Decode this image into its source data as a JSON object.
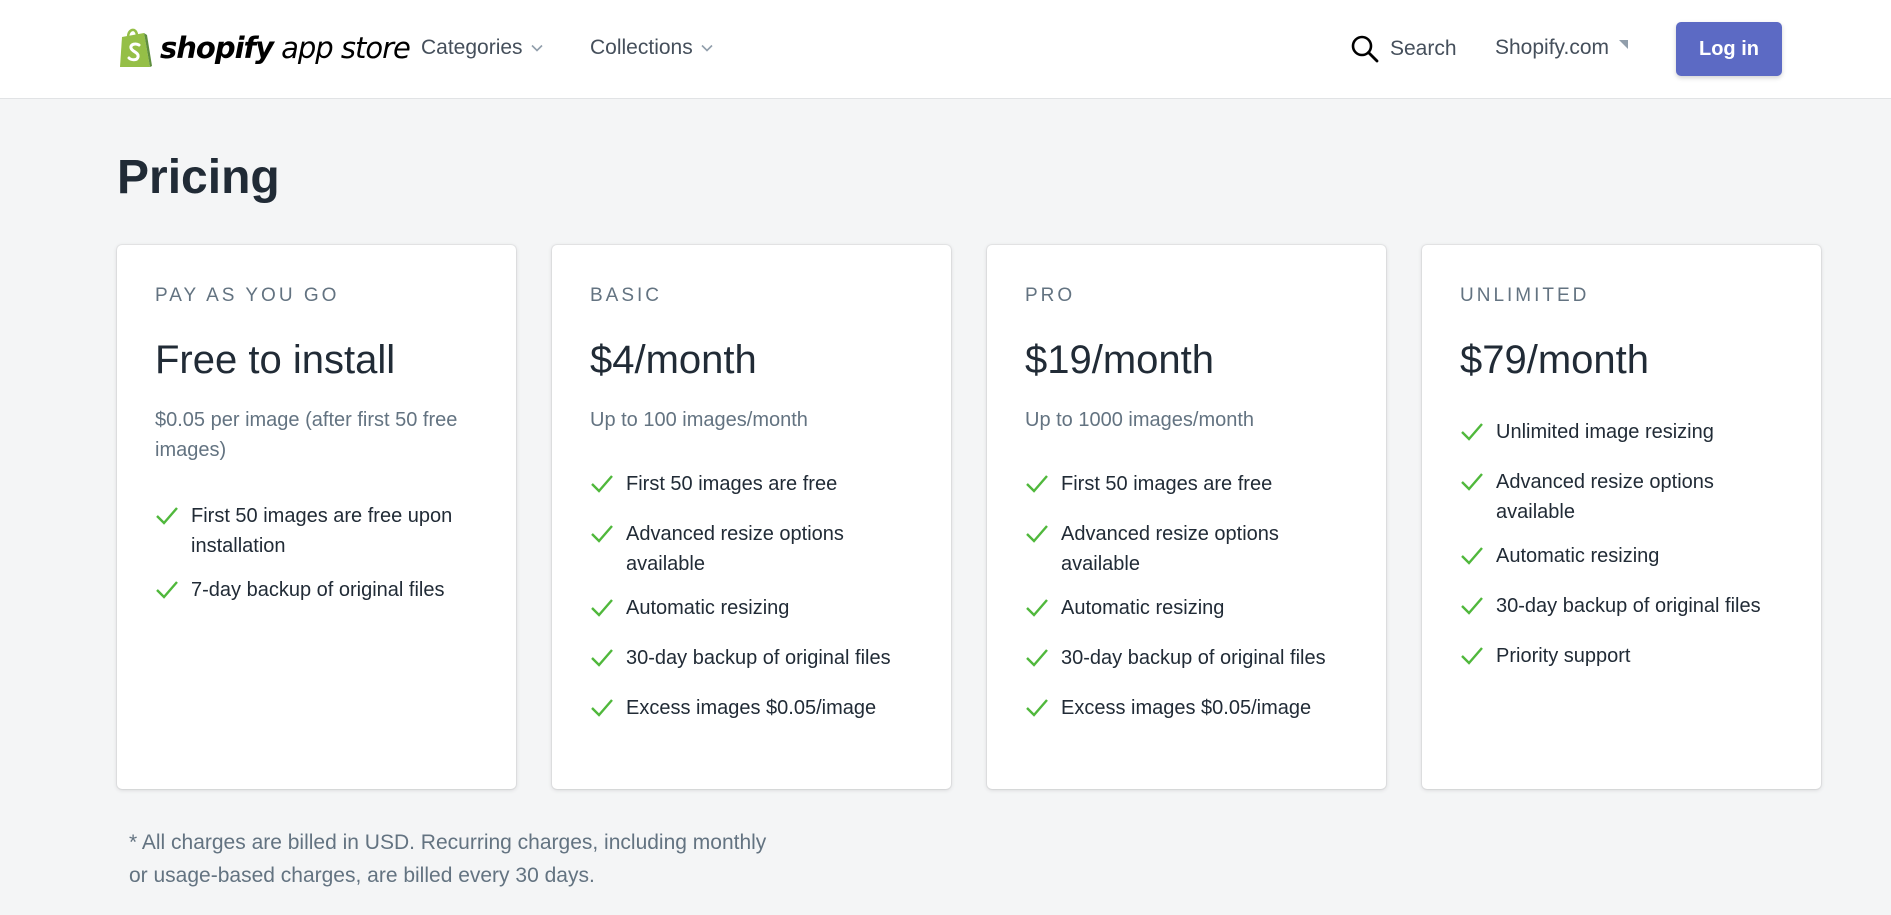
{
  "header": {
    "logo_word": "shopify",
    "logo_suffix": "app store",
    "nav": {
      "categories_label": "Categories",
      "collections_label": "Collections"
    },
    "search_label": "Search",
    "shopify_link_label": "Shopify.com",
    "login_label": "Log in",
    "colors": {
      "brand_green": "#95bf47",
      "accent": "#5c6ac4"
    }
  },
  "main": {
    "title": "Pricing",
    "plans": [
      {
        "name": "PAY AS YOU GO",
        "price": "Free to install",
        "description": "$0.05 per image (after first 50 free images)",
        "features": [
          "First 50 images are free upon installation",
          "7-day backup of original files"
        ]
      },
      {
        "name": "BASIC",
        "price": "$4/month",
        "description": "Up to 100 images/month",
        "features": [
          "First 50 images are free",
          "Advanced resize options available",
          "Automatic resizing",
          "30-day backup of original files",
          "Excess images $0.05/image"
        ]
      },
      {
        "name": "PRO",
        "price": "$19/month",
        "description": "Up to 1000 images/month",
        "features": [
          "First 50 images are free",
          "Advanced resize options available",
          "Automatic resizing",
          "30-day backup of original files",
          "Excess images $0.05/image"
        ]
      },
      {
        "name": "UNLIMITED",
        "price": "$79/month",
        "features": [
          "Unlimited image resizing",
          "Advanced resize options available",
          "Automatic resizing",
          "30-day backup of original files",
          "Priority support"
        ]
      }
    ],
    "footnote": "* All charges are billed in USD. Recurring charges, including monthly or usage-based charges, are billed every 30 days.",
    "icons": {
      "feature": "checkmark-icon",
      "check_color": "#50b83c"
    }
  }
}
